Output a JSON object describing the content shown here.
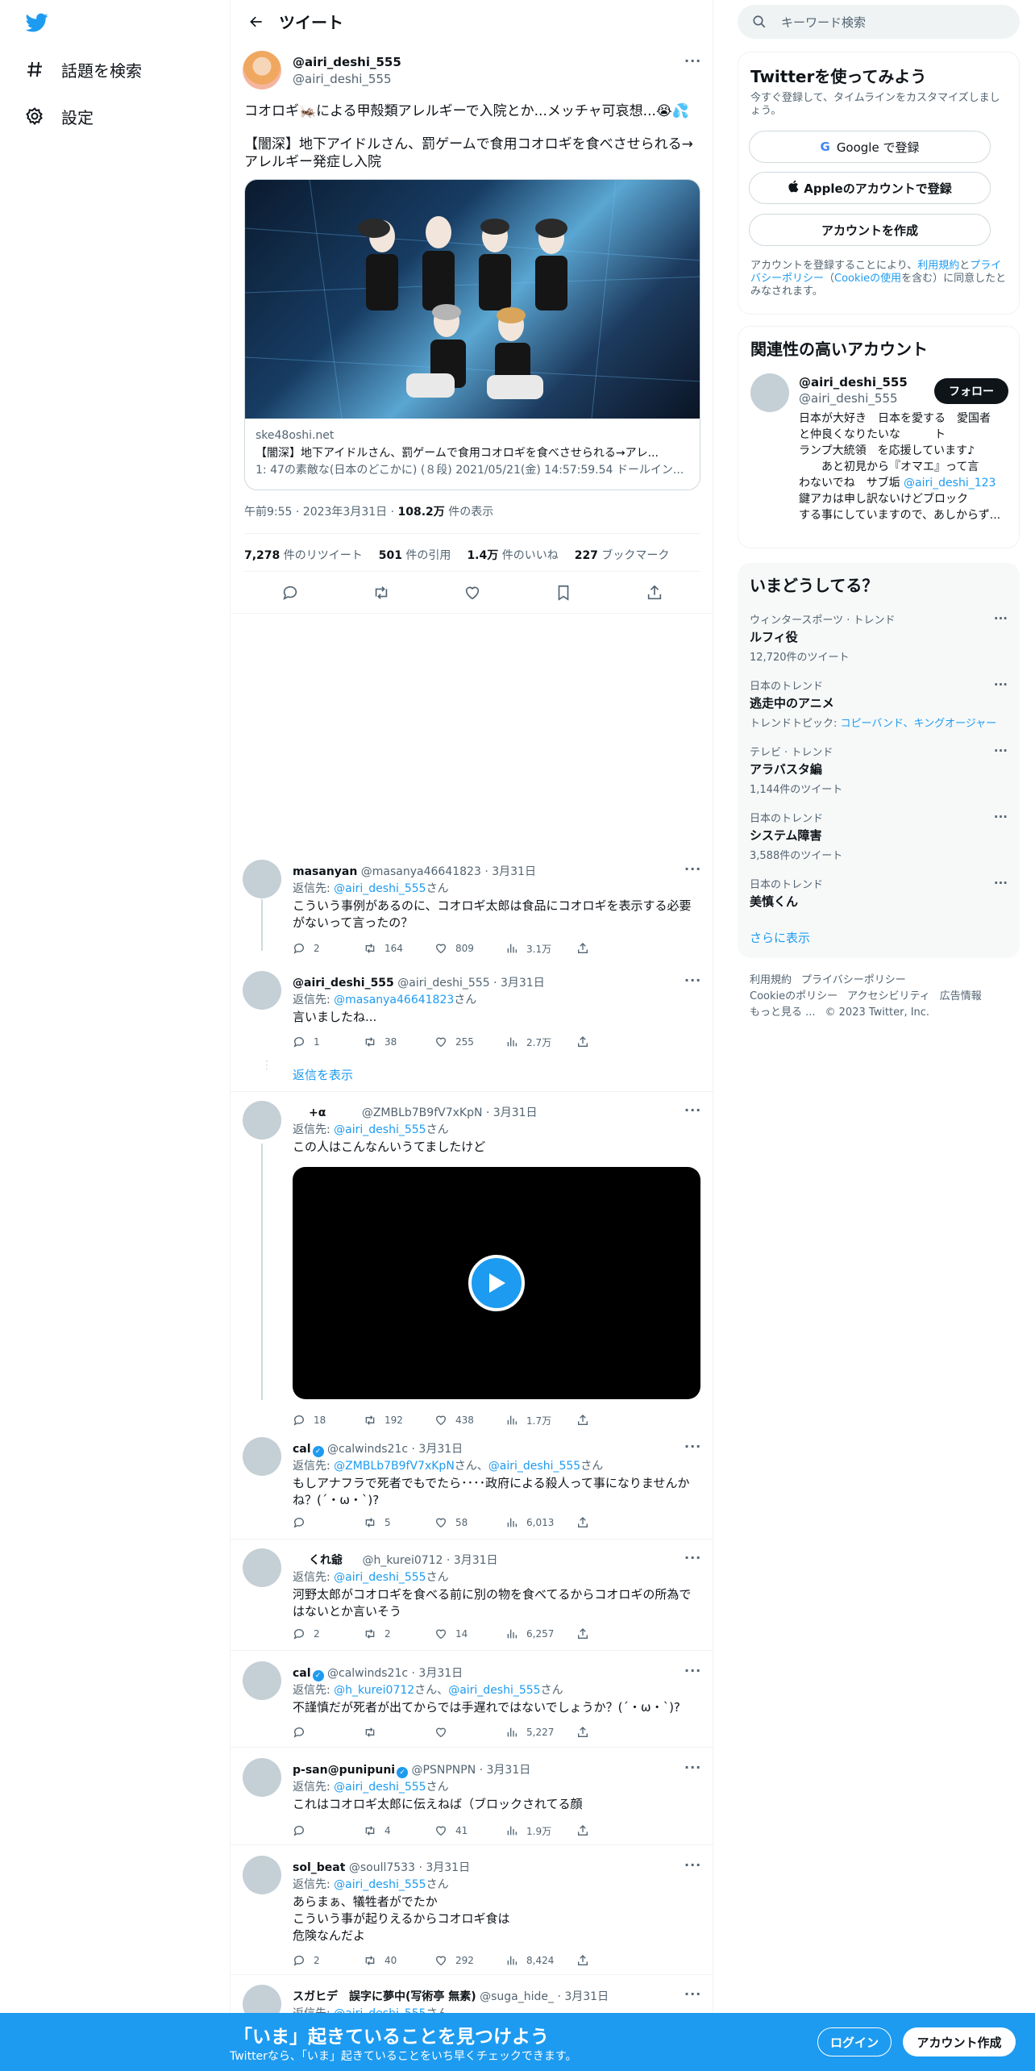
{
  "nav": {
    "explore": "話題を検索",
    "settings": "設定"
  },
  "header": {
    "title": "ツイート"
  },
  "tweet": {
    "name": "@airi_deshi_555",
    "handle": "@airi_deshi_555",
    "text1": "コオロギ🦗による甲殻類アレルギーで入院とか...メッチャ可哀想...😭💦",
    "text2": "【闇深】地下アイドルさん、罰ゲームで食用コオロギを食べさせられる→アレルギー発症し入院",
    "card": {
      "domain": "ske48oshi.net",
      "title": "【闇深】地下アイドルさん、罰ゲームで食用コオロギを食べさせられる→アレ...",
      "desc": "1: 47の素敵な(日本のどこかに) (８段) 2021/05/21(金) 14:57:59.54 ドールイン..."
    },
    "time": "午前9:55 · 2023年3月31日 · ",
    "views_count": "108.2万",
    "views_label": " 件の表示",
    "retweets": "7,278",
    "retweets_label": " 件のリツイート",
    "quotes": "501",
    "quotes_label": " 件の引用",
    "likes": "1.4万",
    "likes_label": " 件のいいね",
    "bookmarks": "227",
    "bookmarks_label": " ブックマーク"
  },
  "replies": [
    {
      "name": "masanyan",
      "handle": "@masanya46641823 · 3月31日",
      "to_prefix": "返信先: ",
      "to_users": "@airi_deshi_555",
      "to_suffix": "さん",
      "body": "こういう事例があるのに、コオロギ太郎は食品にコオロギを表示する必要がないって言ったの？",
      "replies": "2",
      "retweets": "164",
      "likes": "809",
      "views": "3.1万"
    },
    {
      "name": "@airi_deshi_555",
      "handle": "@airi_deshi_555 · 3月31日",
      "to_prefix": "返信先: ",
      "to_users": "@masanya46641823",
      "to_suffix": "さん",
      "body": "言いましたね...",
      "replies": "1",
      "retweets": "38",
      "likes": "255",
      "views": "2.7万"
    },
    {
      "name": "+α",
      "handle": "@ZMBLb7B9fV7xKpN · 3月31日",
      "to_prefix": "返信先: ",
      "to_users": "@airi_deshi_555",
      "to_suffix": "さん",
      "body": "この人はこんなんいうてましたけど",
      "replies": "18",
      "retweets": "192",
      "likes": "438",
      "views": "1.7万"
    },
    {
      "name": "cal",
      "handle": "@calwinds21c · 3月31日",
      "to_prefix": "返信先: ",
      "to_users": "@ZMBLb7B9fV7xKpN",
      "to_mid": "さん、",
      "to_users2": "@airi_deshi_555",
      "to_suffix": "さん",
      "body": "もしアナフラで死者でもでたら････政府による殺人って事になりませんかね？(´・ω・`)?",
      "replies": "",
      "retweets": "5",
      "likes": "58",
      "views": "6,013"
    },
    {
      "name": "くれ爺",
      "handle": "@h_kurei0712 · 3月31日",
      "to_prefix": "返信先: ",
      "to_users": "@airi_deshi_555",
      "to_suffix": "さん",
      "body": "河野太郎がコオロギを食べる前に別の物を食べてるからコオロギの所為ではないとか言いそう",
      "replies": "2",
      "retweets": "2",
      "likes": "14",
      "views": "6,257"
    },
    {
      "name": "cal",
      "handle": "@calwinds21c · 3月31日",
      "to_prefix": "返信先: ",
      "to_users": "@h_kurei0712",
      "to_mid": "さん、",
      "to_users2": "@airi_deshi_555",
      "to_suffix": "さん",
      "body": "不謹慎だが死者が出てからでは手遅れではないでしょうか？(´・ω・`)?",
      "replies": "",
      "retweets": "",
      "likes": "",
      "views": "5,227"
    },
    {
      "name": "p-san@punipuni",
      "handle": "@PSNPNPN · 3月31日",
      "to_prefix": "返信先: ",
      "to_users": "@airi_deshi_555",
      "to_suffix": "さん",
      "body": "これはコオロギ太郎に伝えねば（ブロックされてる顔",
      "replies": "",
      "retweets": "4",
      "likes": "41",
      "views": "1.9万"
    },
    {
      "name": "sol_beat",
      "handle": "@soull7533 · 3月31日",
      "to_prefix": "返信先: ",
      "to_users": "@airi_deshi_555",
      "to_suffix": "さん",
      "body_lines": [
        "あらまぁ、犠牲者がでたか",
        "こういう事が起りえるからコオロギ食は",
        "危険なんだよ"
      ],
      "replies": "2",
      "retweets": "40",
      "likes": "292",
      "views": "8,424"
    },
    {
      "name": "スガヒデ　誤字に夢中(写術亭 無素)",
      "handle": "@suga_hide_ · 3月31日",
      "to_prefix": "返信先: ",
      "to_users": "@airi_deshi_555",
      "to_suffix": "さん"
    }
  ],
  "show_replies": "返信を表示",
  "right": {
    "search_placeholder": "キーワード検索",
    "signup_title": "Twitterを使ってみよう",
    "signup_sub": "今すぐ登録して、タイムラインをカスタマイズしましょう。",
    "google_btn": "Google で登録",
    "apple_btn": "Appleのアカウントで登録",
    "create_btn": "アカウントを作成",
    "terms_pre": "アカウントを登録することにより、",
    "terms_link1": "利用規約",
    "terms_and": "と",
    "terms_link2": "プライバシーポリシー",
    "terms_paren_open": "（",
    "terms_link3": "Cookieの使用",
    "terms_post": "を含む）に同意したとみなされます。",
    "relevant_title": "関連性の高いアカウント",
    "acc_name": "@airi_deshi_555",
    "acc_handle": "@airi_deshi_555",
    "follow_btn": "フォロー",
    "acc_bio_lines": [
      "日本が大好き　日本を愛する　愛国者　と仲良くなりたいな　　　ト",
      "ランプ大統領　を応援しています♪",
      "　　あと初見から『オマエ』って言",
      "わないでね　サブ垢 "
    ],
    "acc_bio_link": "@airi_deshi_123",
    "acc_bio_rest": [
      "鍵アカは申し訳ないけどブロック",
      "する事にしていますので、あしからず..."
    ],
    "trends_title": "いまどうしてる？",
    "trends": [
      {
        "cat": "ウィンタースポーツ · トレンド",
        "name": "ルフィ役",
        "count": "12,720件のツイート"
      },
      {
        "cat": "日本のトレンド",
        "name": "逃走中のアニメ",
        "count_prefix": "トレンドトピック: ",
        "count_links": "コピーバンド、キングオージャー"
      },
      {
        "cat": "テレビ · トレンド",
        "name": "アラバスタ編",
        "count": "1,144件のツイート"
      },
      {
        "cat": "日本のトレンド",
        "name": "システム障害",
        "count": "3,588件のツイート"
      },
      {
        "cat": "日本のトレンド",
        "name": "美慎くん",
        "count": ""
      }
    ],
    "show_more": "さらに表示",
    "footer": [
      "利用規約",
      "プライバシーポリシー",
      "Cookieのポリシー",
      "アクセシビリティ",
      "広告情報",
      "もっと見る ...",
      "© 2023 Twitter, Inc."
    ]
  },
  "bottom": {
    "title": "「いま」起きていることを見つけよう",
    "sub": "Twitterなら、「いま」起きていることをいち早くチェックできます。",
    "login": "ログイン",
    "signup": "アカウント作成"
  }
}
